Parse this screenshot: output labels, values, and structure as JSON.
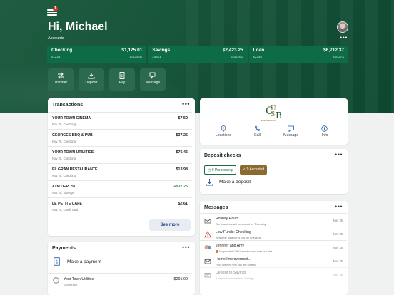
{
  "header": {
    "menu_badge": "1",
    "greeting": "Hi, Michael",
    "accounts_label": "Accounts",
    "more": "•••"
  },
  "accounts": [
    {
      "name": "Checking",
      "number": "x1234",
      "amount": "$1,175.01",
      "kind": "Available"
    },
    {
      "name": "Savings",
      "number": "x4321",
      "amount": "$2,423.25",
      "kind": "Available"
    },
    {
      "name": "Loan",
      "number": "x2345",
      "amount": "$6,712.37",
      "kind": "Balance"
    }
  ],
  "quick_actions": [
    {
      "label": "Transfer",
      "icon": "transfer-icon"
    },
    {
      "label": "Deposit",
      "icon": "deposit-icon"
    },
    {
      "label": "Pay",
      "icon": "pay-icon"
    },
    {
      "label": "Message",
      "icon": "message-icon"
    }
  ],
  "transactions": {
    "title": "Transactions",
    "more": "•••",
    "items": [
      {
        "name": "YOUR TOWN CINEMA",
        "date": "Nov 25, Checking",
        "amount": "$7.50"
      },
      {
        "name": "GEORGES BBQ & PUB",
        "date": "Nov 25, Checking",
        "amount": "$37.25"
      },
      {
        "name": "YOUR TOWN UTILITIES",
        "date": "Nov 25, Checking",
        "amount": "$76.46"
      },
      {
        "name": "EL GRAN RESTAURANTE",
        "date": "Nov 25, Checking",
        "amount": "$13.98"
      },
      {
        "name": "ATM DEPOSIT",
        "date": "Nov 25, Savings",
        "amount": "+$37.25"
      },
      {
        "name": "LE PETITE CAFE",
        "date": "Nov 24, Credit card",
        "amount": "$2.61"
      }
    ],
    "see_more": "See more"
  },
  "bank": {
    "logo_text": "USB",
    "logo_tagline": "Established 1848",
    "actions": [
      {
        "label": "Locations",
        "icon": "location-pin-icon"
      },
      {
        "label": "Call",
        "icon": "phone-icon"
      },
      {
        "label": "Message",
        "icon": "chat-icon"
      },
      {
        "label": "Info",
        "icon": "info-icon"
      }
    ]
  },
  "deposit_checks": {
    "title": "Deposit checks",
    "more": "•••",
    "processing": "0 Processing",
    "accepted": "9 Accepted",
    "make_deposit": "Make a deposit"
  },
  "messages": {
    "title": "Messages",
    "more": "•••",
    "items": [
      {
        "title": "Holiday Hours",
        "preview": "Our branches will be closed on Thursday.",
        "date": "Nov 25",
        "icon": "envelope-icon"
      },
      {
        "title": "Low Funds: Checking",
        "preview": "Available balance is low on Checking.",
        "date": "Nov 25",
        "icon": "warning-icon"
      },
      {
        "title": "Jennifer and Amy",
        "preview": "No problem! We'll send a new card out first...",
        "date": "Nov 25",
        "icon": "group-avatar-icon"
      },
      {
        "title": "Home Improvement...",
        "preview": "Find out how you can get started",
        "date": "Nov 25",
        "icon": "envelope-icon"
      },
      {
        "title": "Deposit to Savings",
        "preview": "A deposit was made to Savings",
        "date": "Nov 25",
        "icon": "envelope-icon"
      }
    ]
  },
  "payments": {
    "title": "Payments",
    "more": "•••",
    "make_payment": "Make a payment",
    "items": [
      {
        "name": "Your Town Utilities",
        "status": "Scheduled",
        "amount": "$291.00"
      }
    ]
  },
  "colors": {
    "brand_green": "#1f5c40",
    "account_tile": "#0d6b46",
    "positive": "#2a8a3e",
    "accepted_chip": "#8a6a2e",
    "alert_red": "#d93a2b"
  }
}
